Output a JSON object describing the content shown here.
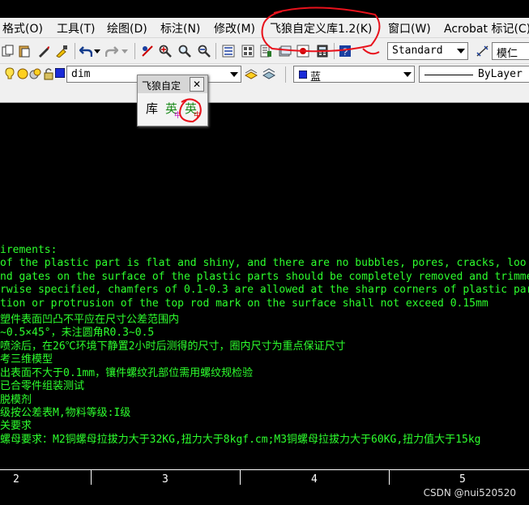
{
  "menu": {
    "items": [
      {
        "id": "format",
        "label": "格式(O)"
      },
      {
        "id": "tools",
        "label": "工具(T)"
      },
      {
        "id": "draw",
        "label": "绘图(D)"
      },
      {
        "id": "dimension",
        "label": "标注(N)"
      },
      {
        "id": "modify",
        "label": "修改(M)"
      },
      {
        "id": "feilang",
        "label": "飞狼自定义库1.2(K)"
      },
      {
        "id": "window",
        "label": "窗口(W)"
      },
      {
        "id": "acrobat",
        "label": "Acrobat 标记(C)"
      }
    ]
  },
  "toolbar": {
    "text_style": "Standard",
    "dim_style": "模仁",
    "layer_name": "dim",
    "color_name": "蓝",
    "linetype": "ByLayer"
  },
  "floating_toolbar": {
    "title": "飞狼自定",
    "close_label": "✕",
    "buttons": [
      {
        "id": "lib",
        "label": "库"
      },
      {
        "id": "cn",
        "label": "英"
      },
      {
        "id": "en",
        "label": "英"
      }
    ]
  },
  "canvas_text": [
    "irements:",
    " of the plastic part is flat and shiny, and there are no bubbles, pores, cracks, loo",
    "nd gates on the surface of the plastic parts should be completely removed and trimme",
    "rwise specified, chamfers of 0.1-0.3 are allowed at the sharp corners of plastic par",
    "tion or protrusion of the top rod mark on the surface shall not exceed 0.15mm",
    "塑件表面凹凸不平应在尺寸公差范围内",
    "~0.5×45°，未注圆角R0.3~0.5",
    "喷涂后，在26℃环境下静置2小时后测得的尺寸，圈内尺寸为重点保证尺寸",
    "考三维模型",
    "出表面不大于0.1mm，镶件螺纹孔部位需用螺纹规检验",
    "已合零件组装测试",
    "脱模剂",
    "级按公差表M,物料等级:I级",
    "关要求",
    "螺母要求：M2铜螺母拉拔力大于32KG,扭力大于8kgf.cm;M3铜螺母拉拔力大于60KG,扭力值大于15kg"
  ],
  "status": {
    "columns": [
      "2",
      "3",
      "4",
      "5"
    ],
    "watermark": "CSDN @nui520520"
  },
  "colors": {
    "text": "#2dff2d",
    "canvas": "#000000",
    "annotation": "#e8121c"
  }
}
